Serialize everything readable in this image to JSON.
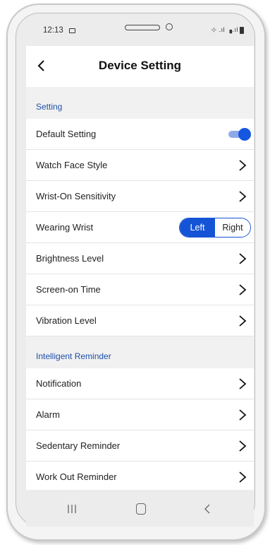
{
  "status_bar": {
    "time": "12:13",
    "right_icons": "⊹ .ıl ▗.ıl"
  },
  "header": {
    "title": "Device Setting",
    "back_icon": "chevron-left-icon"
  },
  "sections": {
    "setting": {
      "title": "Setting",
      "default_setting": {
        "label": "Default Setting",
        "toggle_on": true
      },
      "watch_face_style": {
        "label": "Watch Face Style"
      },
      "wrist_on_sensitivity": {
        "label": "Wrist-On Sensitivity"
      },
      "wearing_wrist": {
        "label": "Wearing Wrist",
        "options": [
          "Left",
          "Right"
        ],
        "selected": "Left"
      },
      "brightness_level": {
        "label": "Brightness Level"
      },
      "screen_on_time": {
        "label": "Screen-on Time"
      },
      "vibration_level": {
        "label": "Vibration Level"
      }
    },
    "intelligent_reminder": {
      "title": "Intelligent Reminder",
      "notification": {
        "label": "Notification"
      },
      "alarm": {
        "label": "Alarm"
      },
      "sedentary_reminder": {
        "label": "Sedentary Reminder"
      },
      "work_out_reminder": {
        "label": "Work Out Reminder"
      }
    }
  },
  "colors": {
    "accent": "#1554d6",
    "section_title": "#1f4fa8",
    "toggle_track": "#8fa9e8"
  }
}
